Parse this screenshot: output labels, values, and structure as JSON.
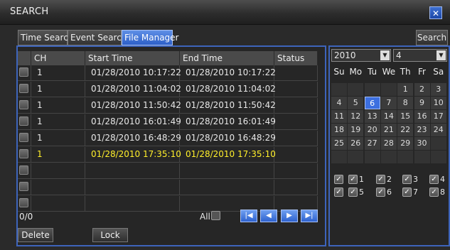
{
  "window": {
    "title": "SEARCH",
    "close_icon": "close-icon"
  },
  "tabs": [
    {
      "label": "Time Search",
      "active": false
    },
    {
      "label": "Event Search",
      "active": false
    },
    {
      "label": "File Manager",
      "active": true
    }
  ],
  "search_button": "Search",
  "table": {
    "columns": [
      "CH",
      "Start Time",
      "End Time",
      "Status"
    ],
    "rows": [
      {
        "ch": "1",
        "start": "01/28/2010 10:17:22",
        "end": "01/28/2010 10:17:22",
        "status": "",
        "highlight": false
      },
      {
        "ch": "1",
        "start": "01/28/2010 11:04:02",
        "end": "01/28/2010 11:04:02",
        "status": "",
        "highlight": false
      },
      {
        "ch": "1",
        "start": "01/28/2010 11:50:42",
        "end": "01/28/2010 11:50:42",
        "status": "",
        "highlight": false
      },
      {
        "ch": "1",
        "start": "01/28/2010 16:01:49",
        "end": "01/28/2010 16:01:49",
        "status": "",
        "highlight": false
      },
      {
        "ch": "1",
        "start": "01/28/2010 16:48:29",
        "end": "01/28/2010 16:48:29",
        "status": "",
        "highlight": false
      },
      {
        "ch": "1",
        "start": "01/28/2010 17:35:10",
        "end": "01/28/2010 17:35:10",
        "status": "",
        "highlight": true
      },
      {
        "ch": "",
        "start": "",
        "end": "",
        "status": "",
        "highlight": false
      },
      {
        "ch": "",
        "start": "",
        "end": "",
        "status": "",
        "highlight": false
      },
      {
        "ch": "",
        "start": "",
        "end": "",
        "status": "",
        "highlight": false
      }
    ]
  },
  "pagination": {
    "count": "0/0",
    "all_label": "All"
  },
  "actions": {
    "delete": "Delete",
    "lock": "Lock"
  },
  "calendar": {
    "year": "2010",
    "month": "4",
    "weekdays": [
      "Su",
      "Mo",
      "Tu",
      "We",
      "Th",
      "Fr",
      "Sa"
    ],
    "weeks": [
      [
        "",
        "",
        "",
        "",
        "1",
        "2",
        "3"
      ],
      [
        "4",
        "5",
        "6",
        "7",
        "8",
        "9",
        "10"
      ],
      [
        "11",
        "12",
        "13",
        "14",
        "15",
        "16",
        "17"
      ],
      [
        "18",
        "19",
        "20",
        "21",
        "22",
        "23",
        "24"
      ],
      [
        "25",
        "26",
        "27",
        "28",
        "29",
        "30",
        ""
      ]
    ],
    "selected_day": "6"
  },
  "channels": {
    "row1": [
      {
        "label": "",
        "checked": true
      },
      {
        "label": "1",
        "checked": true
      },
      {
        "label": "2",
        "checked": true
      },
      {
        "label": "3",
        "checked": true
      },
      {
        "label": "4",
        "checked": true
      }
    ],
    "row2": [
      {
        "label": "",
        "checked": true
      },
      {
        "label": "5",
        "checked": true
      },
      {
        "label": "6",
        "checked": true
      },
      {
        "label": "7",
        "checked": true
      },
      {
        "label": "8",
        "checked": true
      }
    ]
  },
  "colors": {
    "accent": "#3d64bb",
    "highlight": "#ffef2a",
    "selected_day": "#3c6fe0"
  }
}
